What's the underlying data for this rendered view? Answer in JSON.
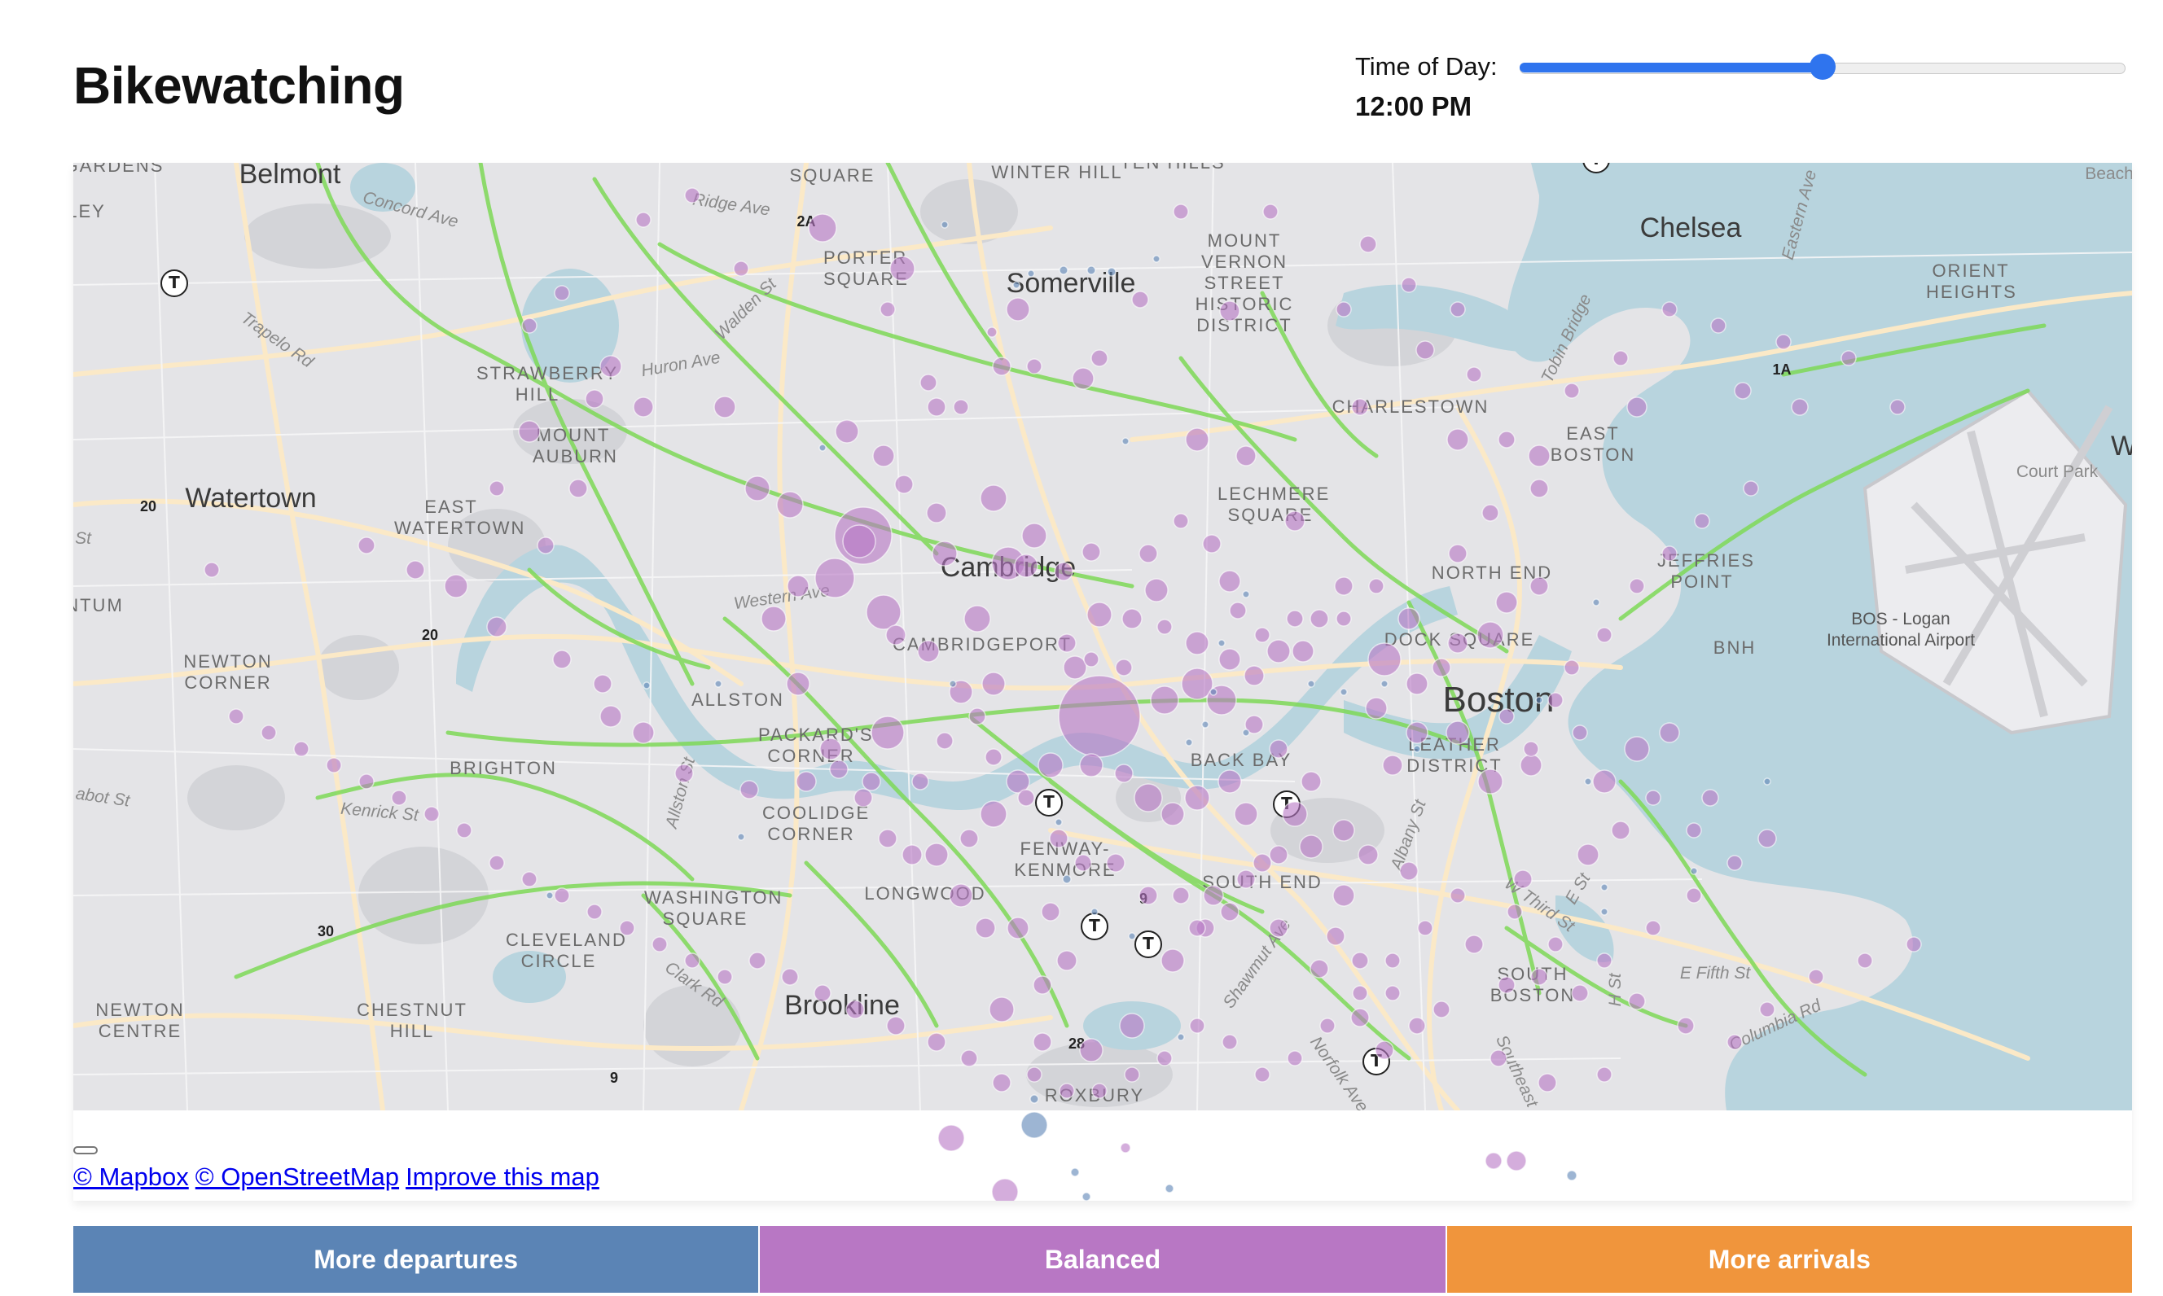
{
  "page": {
    "title": "Bikewatching"
  },
  "time_control": {
    "label": "Time of Day:",
    "value_text": "12:00 PM",
    "slider_fraction": 0.5
  },
  "map": {
    "provider": "Mapbox",
    "region": "Boston / Cambridge",
    "colors": {
      "land": "#e4e4e7",
      "water": "#b8d4de",
      "park": "#d2d3d6",
      "road": "#fbe9c7",
      "bike_lane": "#7ed957",
      "station_balanced": "#b877c4",
      "station_departures": "#5b84b5"
    },
    "labels": {
      "belmont": "Belmont",
      "somerville": "Somerville",
      "chelsea": "Chelsea",
      "cambridge": "Cambridge",
      "watertown": "Watertown",
      "boston": "Boston",
      "brookline": "Brookline",
      "winter_hill": "WINTER HILL",
      "ten_hills": "TEN HILLS",
      "square": "SQUARE",
      "porter": "PORTER SQUARE",
      "mount_vernon": "MOUNT VERNON STREET HISTORIC DISTRICT",
      "orient": "ORIENT HEIGHTS",
      "charlestown": "CHARLESTOWN",
      "east_boston": "EAST BOSTON",
      "strawberry": "STRAWBERRY HILL",
      "mount_auburn": "MOUNT AUBURN",
      "east_watertown": "EAST WATERTOWN",
      "lechmere": "LECHMERE SQUARE",
      "north_end": "NORTH END",
      "jeffries": "JEFFRIES POINT",
      "bos_airport": "BOS - Logan International Airport",
      "court_park": "Court Park",
      "bnh": "BNH",
      "cambridgeport": "CAMBRIDGEPORT",
      "dock_square": "DOCK SQUARE",
      "newton_corner": "NEWTON CORNER",
      "allston": "ALLSTON",
      "packards": "PACKARD'S CORNER",
      "leather": "LEATHER DISTRICT",
      "back_bay": "BACK BAY",
      "brighton": "BRIGHTON",
      "coolidge": "COOLIDGE CORNER",
      "fenway": "FENWAY-KENMORE",
      "south_end": "SOUTH END",
      "washington_sq": "WASHINGTON SQUARE",
      "longwood": "LONGWOOD",
      "cleveland": "CLEVELAND CIRCLE",
      "newton_centre": "NEWTON CENTRE",
      "chestnut": "CHESTNUT HILL",
      "south_boston": "SOUTH BOSTON",
      "roxbury": "ROXBURY",
      "gardens": "GARDENS",
      "ley": "LEY",
      "ntum": "NTUM",
      "beach": "Beach",
      "w": "W",
      "concord": "Concord Ave",
      "ridge": "Ridge Ave",
      "walden": "Walden St",
      "huron": "Huron Ave",
      "trapelo": "Trapelo Rd",
      "eastern": "Eastern Ave",
      "tobin": "Tobin Bridge",
      "western": "Western Ave",
      "st": "St",
      "abot": "abot St",
      "kenrick": "Kenrick St",
      "allston_st": "Allston St",
      "albany": "Albany St",
      "w_third": "W Third St",
      "e_st": "E St",
      "clark": "Clark Rd",
      "shawmut": "Shawmut Ave",
      "e_fifth": "E Fifth St",
      "columbia": "Columbia Rd",
      "southeast": "Southeast",
      "norfolk": "Norfolk Ave",
      "h_st": "H St",
      "r_2a": "2A",
      "r_1a": "1A",
      "r_20a": "20",
      "r_20b": "20",
      "r_30": "30",
      "r_9": "9",
      "r_9b": "9",
      "r_28": "28"
    },
    "transit_icon": "metro-station-icon",
    "transit_glyph": "T"
  },
  "attribution": {
    "mapbox": "© Mapbox",
    "osm": "© OpenStreetMap",
    "improve": "Improve this map"
  },
  "legend": {
    "items": [
      {
        "label": "More departures",
        "color": "#5b84b5"
      },
      {
        "label": "Balanced",
        "color": "#b877c4"
      },
      {
        "label": "More arrivals",
        "color": "#f0953c"
      }
    ]
  }
}
